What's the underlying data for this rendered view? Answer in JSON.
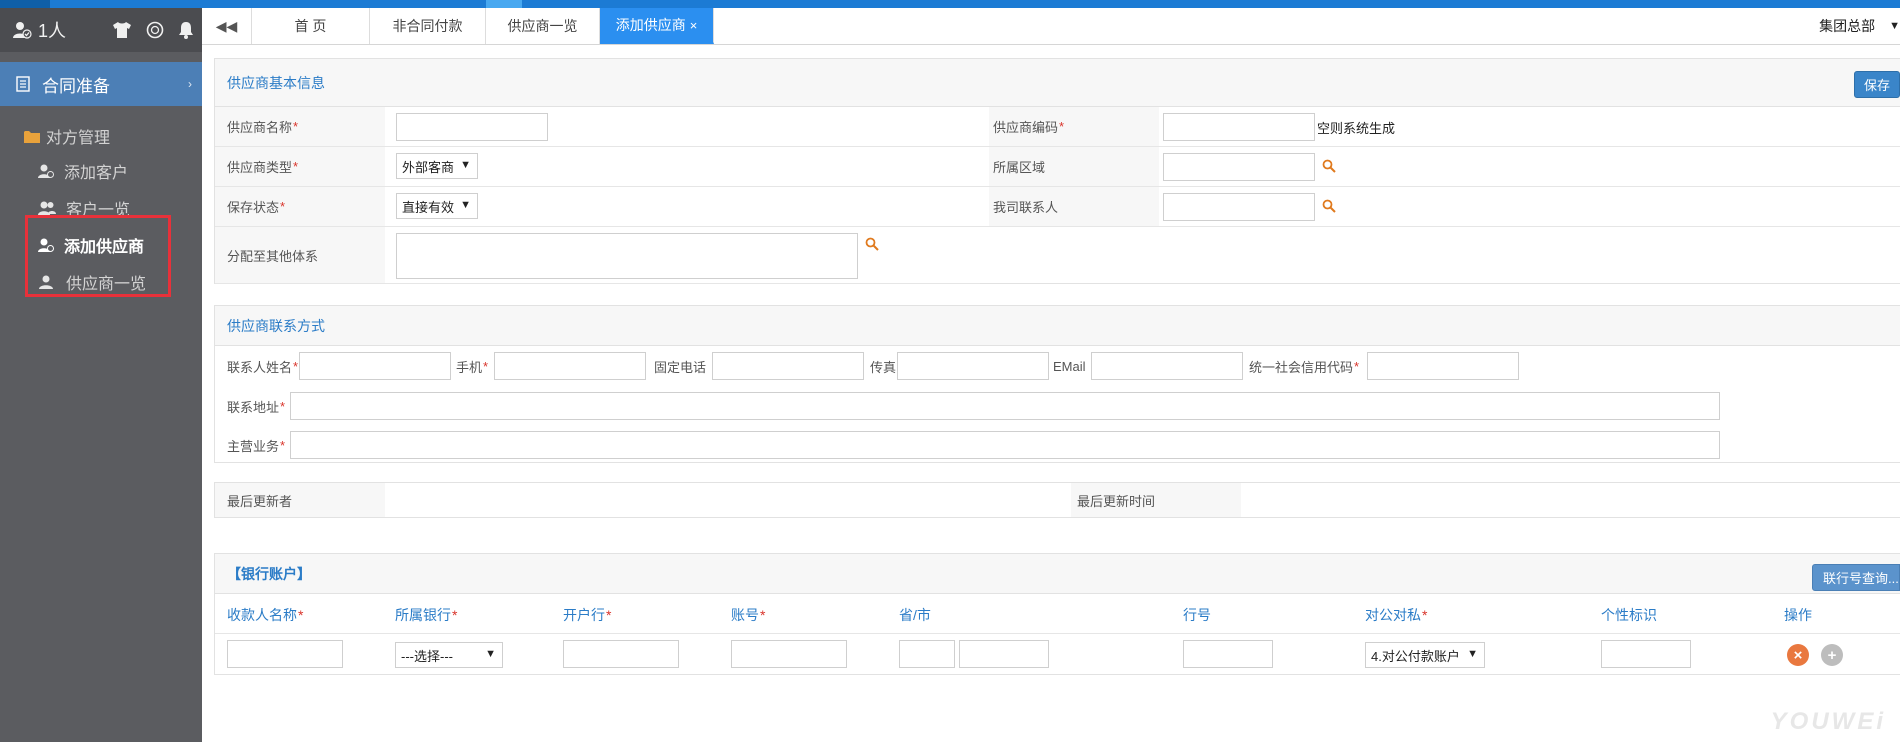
{
  "sidebar": {
    "user_label": "1人",
    "section_title": "合同准备",
    "folder_label": "对方管理",
    "items": [
      {
        "label": "添加客户"
      },
      {
        "label": "客户一览"
      },
      {
        "label": "添加供应商"
      },
      {
        "label": "供应商一览"
      }
    ]
  },
  "tabs": {
    "items": [
      {
        "label": "首 页"
      },
      {
        "label": "非合同付款"
      },
      {
        "label": "供应商一览"
      },
      {
        "label": "添加供应商",
        "close": "×"
      }
    ],
    "org": "集团总部"
  },
  "basic": {
    "title": "供应商基本信息",
    "save": "保存",
    "name_label": "供应商名称",
    "type_label": "供应商类型",
    "type_value": "外部客商",
    "status_label": "保存状态",
    "status_value": "直接有效",
    "assign_label": "分配至其他体系",
    "code_label": "供应商编码",
    "code_hint": "空则系统生成",
    "region_label": "所属区域",
    "contact_label": "我司联系人"
  },
  "contact": {
    "title": "供应商联系方式",
    "name_label": "联系人姓名",
    "mobile_label": "手机",
    "phone_label": "固定电话",
    "fax_label": "传真",
    "email_label": "EMail",
    "credit_label": "统一社会信用代码",
    "address_label": "联系地址",
    "business_label": "主营业务"
  },
  "update": {
    "updater_label": "最后更新者",
    "time_label": "最后更新时间"
  },
  "bank": {
    "title": "【银行账户】",
    "query_btn": "联行号查询...",
    "headers": {
      "payee": "收款人名称",
      "bank": "所属银行",
      "branch": "开户行",
      "account": "账号",
      "province": "省/市",
      "bankno": "行号",
      "type": "对公对私",
      "tag": "个性标识",
      "op": "操作"
    },
    "bank_select": "---选择---",
    "type_select": "4.对公付款账户"
  },
  "req_mark": "*",
  "watermark": "YOUWEi"
}
